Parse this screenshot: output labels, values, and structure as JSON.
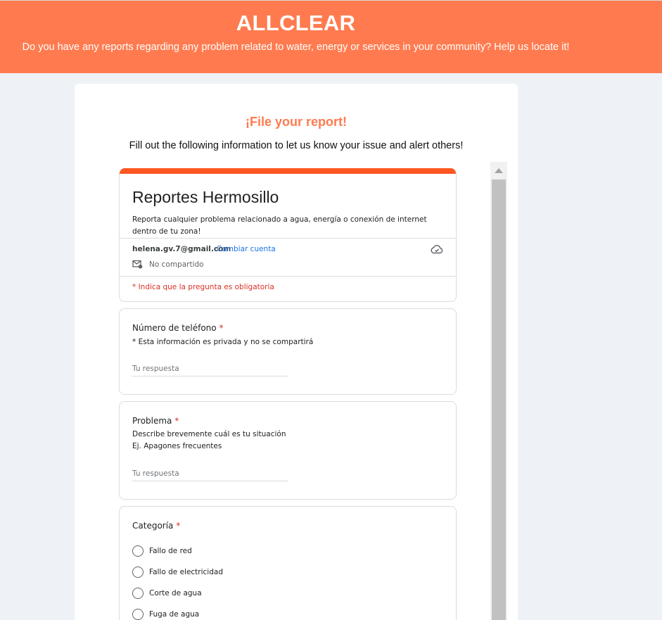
{
  "header": {
    "brand": "ALLCLEAR",
    "tagline": "Do you have any reports regarding any problem related to water, energy or services in your community? Help us locate it!"
  },
  "card": {
    "title": "¡File your report!",
    "subtitle": "Fill out the following information to let us know your issue and alert others!"
  },
  "form": {
    "title": "Reportes Hermosillo",
    "description": "Reporta cualquier problema relacionado a agua, energía o conexión de internet dentro de tu zona!",
    "account_email": "helena.gv.7@gmail.com",
    "switch_account": "Cambiar cuenta",
    "not_shared": "No compartido",
    "required_note": "* Indica que la pregunta es obligatoria",
    "accent_color": "#ff5722",
    "questions": [
      {
        "label": "Número de teléfono",
        "required_mark": "*",
        "hint_lines": [
          "* Esta información es privada y no se compartirá"
        ],
        "placeholder": "Tu respuesta"
      },
      {
        "label": "Problema",
        "required_mark": "*",
        "hint_lines": [
          "Describe brevemente cuál es tu situación",
          "Ej. Apagones frecuentes"
        ],
        "placeholder": "Tu respuesta"
      },
      {
        "label": "Categoría",
        "required_mark": "*",
        "options": [
          "Fallo de red",
          "Fallo de electricidad",
          "Corte de agua",
          "Fuga de agua"
        ]
      }
    ]
  },
  "icons": {
    "cloud": "cloud-saved-icon",
    "mail": "mail-lock-icon",
    "scroll_up": "scroll-up-arrow-icon"
  },
  "colors": {
    "header_bg": "#ff7b4f",
    "title": "#ff7b4f",
    "required": "#d93025",
    "link": "#1a73e8"
  }
}
